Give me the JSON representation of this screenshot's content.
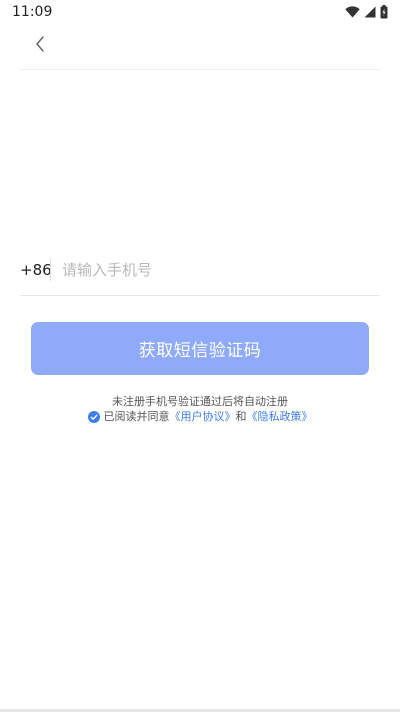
{
  "status_bar": {
    "time": "11:09",
    "icons": [
      "wifi-icon",
      "signal-icon",
      "battery-icon"
    ]
  },
  "nav": {
    "back_icon": "chevron-left-icon"
  },
  "phone": {
    "country_code": "+86",
    "placeholder": "请输入手机号",
    "value": ""
  },
  "sms_button": {
    "label": "获取短信验证码",
    "color": "#8faaf9"
  },
  "hint": "未注册手机号验证通过后将自动注册",
  "agreement": {
    "checked": true,
    "prefix": "已阅读并同意",
    "user_agreement": "《用户协议》",
    "and": "和",
    "privacy_policy": "《隐私政策》",
    "link_color": "#3d7eea"
  }
}
